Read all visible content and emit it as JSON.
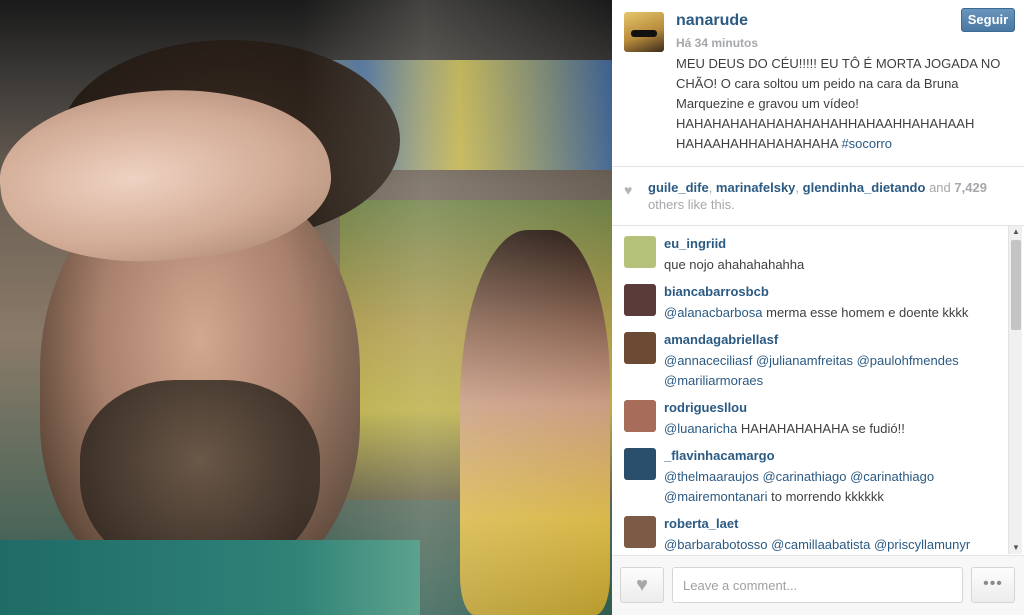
{
  "post": {
    "username": "nanarude",
    "time": "Há 34 minutos",
    "follow_label": "Seguir",
    "caption_text": "MEU DEUS DO CÉU!!!!! EU TÔ É MORTA JOGADA NO CHÃO! O cara soltou um peido na cara da Bruna Marquezine e gravou um vídeo! HAHAHAHAHAHAHAHAHAHHAHAAHHAHAHAAH HAHAAHAHHAHAHAHAHA",
    "caption_tag": "#socorro"
  },
  "likes": {
    "user1": "guile_dife",
    "user2": "marinafelsky",
    "user3": "glendinha_dietando",
    "and": "and",
    "count": "7,429",
    "suffix": "others like this."
  },
  "comments": [
    {
      "user": "eu_ingriid",
      "mentions": "",
      "text": "que nojo ahahahahahha",
      "avatar_color": "#b5c27a"
    },
    {
      "user": "biancabarrosbcb",
      "mentions": "@alanacbarbosa",
      "text": "merma esse homem e doente kkkk",
      "avatar_color": "#5b3a3a"
    },
    {
      "user": "amandagabriellasf",
      "mentions": "@annaceciliasf @julianamfreitas  @paulohfmendes @mariliarmoraes",
      "text": "",
      "avatar_color": "#6d4a34"
    },
    {
      "user": "rodriguesllou",
      "mentions": "@luanaricha",
      "text": "HAHAHAHAHAHA se fudió!!",
      "avatar_color": "#a76d5a"
    },
    {
      "user": "_flavinhacamargo",
      "mentions": "@thelmaaraujos @carinathiago @carinathiago @mairemontanari",
      "text": "to morrendo kkkkkk",
      "avatar_color": "#2a4f6c"
    },
    {
      "user": "roberta_laet",
      "mentions": "@barbarabotosso @camillaabatista @priscyllamunyr",
      "text": "",
      "avatar_color": "#7c5a45"
    }
  ],
  "footer": {
    "comment_placeholder": "Leave a comment...",
    "more_label": "•••"
  }
}
